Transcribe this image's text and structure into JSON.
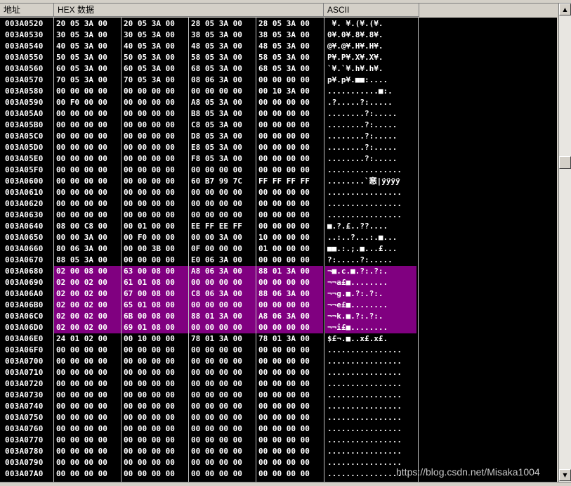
{
  "header": {
    "addr_label": "地址",
    "hex_label": "HEX 数据",
    "ascii_label": "ASCII"
  },
  "scrollbar": {
    "up_glyph": "▲",
    "down_glyph": "▼"
  },
  "watermark": "https://blog.csdn.net/Misaka1004",
  "rows": [
    {
      "addr": "003A0520",
      "g": [
        "20 05 3A 00",
        "20 05 3A 00",
        "28 05 3A 00",
        "28 05 3A 00"
      ],
      "ascii": " ¥. ¥.(¥.(¥.",
      "sel": false
    },
    {
      "addr": "003A0530",
      "g": [
        "30 05 3A 00",
        "30 05 3A 00",
        "38 05 3A 00",
        "38 05 3A 00"
      ],
      "ascii": "0¥.0¥.8¥.8¥.",
      "sel": false
    },
    {
      "addr": "003A0540",
      "g": [
        "40 05 3A 00",
        "40 05 3A 00",
        "48 05 3A 00",
        "48 05 3A 00"
      ],
      "ascii": "@¥.@¥.H¥.H¥.",
      "sel": false
    },
    {
      "addr": "003A0550",
      "g": [
        "50 05 3A 00",
        "50 05 3A 00",
        "58 05 3A 00",
        "58 05 3A 00"
      ],
      "ascii": "P¥.P¥.X¥.X¥.",
      "sel": false
    },
    {
      "addr": "003A0560",
      "g": [
        "60 05 3A 00",
        "60 05 3A 00",
        "68 05 3A 00",
        "68 05 3A 00"
      ],
      "ascii": "`¥.`¥.h¥.h¥.",
      "sel": false
    },
    {
      "addr": "003A0570",
      "g": [
        "70 05 3A 00",
        "70 05 3A 00",
        "08 06 3A 00",
        "00 00 00 00"
      ],
      "ascii": "p¥.p¥.■■:....",
      "sel": false
    },
    {
      "addr": "003A0580",
      "g": [
        "00 00 00 00",
        "00 00 00 00",
        "00 00 00 00",
        "00 10 3A 00"
      ],
      "ascii": "...........■:.",
      "sel": false
    },
    {
      "addr": "003A0590",
      "g": [
        "00 F0 00 00",
        "00 00 00 00",
        "A8 05 3A 00",
        "00 00 00 00"
      ],
      "ascii": ".?.....?:.....",
      "sel": false
    },
    {
      "addr": "003A05A0",
      "g": [
        "00 00 00 00",
        "00 00 00 00",
        "B8 05 3A 00",
        "00 00 00 00"
      ],
      "ascii": "........?:.....",
      "sel": false
    },
    {
      "addr": "003A05B0",
      "g": [
        "00 00 00 00",
        "00 00 00 00",
        "C8 05 3A 00",
        "00 00 00 00"
      ],
      "ascii": "........?:.....",
      "sel": false
    },
    {
      "addr": "003A05C0",
      "g": [
        "00 00 00 00",
        "00 00 00 00",
        "D8 05 3A 00",
        "00 00 00 00"
      ],
      "ascii": "........?:.....",
      "sel": false
    },
    {
      "addr": "003A05D0",
      "g": [
        "00 00 00 00",
        "00 00 00 00",
        "E8 05 3A 00",
        "00 00 00 00"
      ],
      "ascii": "........?:.....",
      "sel": false
    },
    {
      "addr": "003A05E0",
      "g": [
        "00 00 00 00",
        "00 00 00 00",
        "F8 05 3A 00",
        "00 00 00 00"
      ],
      "ascii": "........?:.....",
      "sel": false
    },
    {
      "addr": "003A05F0",
      "g": [
        "00 00 00 00",
        "00 00 00 00",
        "00 00 00 00",
        "00 00 00 00"
      ],
      "ascii": "................",
      "sel": false
    },
    {
      "addr": "003A0600",
      "g": [
        "00 00 00 00",
        "00 00 00 00",
        "60 B7 99 7C",
        "FF FF FF FF"
      ],
      "ascii": "........`窸|ÿÿÿÿ",
      "sel": false
    },
    {
      "addr": "003A0610",
      "g": [
        "00 00 00 00",
        "00 00 00 00",
        "00 00 00 00",
        "00 00 00 00"
      ],
      "ascii": "................",
      "sel": false
    },
    {
      "addr": "003A0620",
      "g": [
        "00 00 00 00",
        "00 00 00 00",
        "00 00 00 00",
        "00 00 00 00"
      ],
      "ascii": "................",
      "sel": false
    },
    {
      "addr": "003A0630",
      "g": [
        "00 00 00 00",
        "00 00 00 00",
        "00 00 00 00",
        "00 00 00 00"
      ],
      "ascii": "................",
      "sel": false
    },
    {
      "addr": "003A0640",
      "g": [
        "08 00 C8 00",
        "00 01 00 00",
        "EE FF EE FF",
        "00 00 00 00"
      ],
      "ascii": "■.?.£..??....",
      "sel": false
    },
    {
      "addr": "003A0650",
      "g": [
        "00 00 3A 00",
        "00 F0 00 00",
        "00 00 3A 00",
        "10 00 00 00"
      ],
      "ascii": "..:..?...:.■...",
      "sel": false
    },
    {
      "addr": "003A0660",
      "g": [
        "80 06 3A 00",
        "00 00 3B 00",
        "0F 00 00 00",
        "01 00 00 00"
      ],
      "ascii": "■■.:.;.■...£...",
      "sel": false
    },
    {
      "addr": "003A0670",
      "g": [
        "88 05 3A 00",
        "00 00 00 00",
        "E0 06 3A 00",
        "00 00 00 00"
      ],
      "ascii": "?:.....?:.....",
      "sel": false
    },
    {
      "addr": "003A0680",
      "g": [
        "02 00 08 00",
        "63 00 08 00",
        "A8 06 3A 00",
        "88 01 3A 00"
      ],
      "ascii": "¬■.c.■.?:.?:.",
      "sel": true
    },
    {
      "addr": "003A0690",
      "g": [
        "02 00 02 00",
        "61 01 08 00",
        "00 00 00 00",
        "00 00 00 00"
      ],
      "ascii": "¬¬a£■........",
      "sel": true
    },
    {
      "addr": "003A06A0",
      "g": [
        "02 00 02 00",
        "67 00 08 00",
        "C8 06 3A 00",
        "88 06 3A 00"
      ],
      "ascii": "¬¬g.■.?:.?:.",
      "sel": true
    },
    {
      "addr": "003A06B0",
      "g": [
        "02 00 02 00",
        "65 01 08 00",
        "00 00 00 00",
        "00 00 00 00"
      ],
      "ascii": "¬¬e£■........",
      "sel": true
    },
    {
      "addr": "003A06C0",
      "g": [
        "02 00 02 00",
        "6B 00 08 00",
        "88 01 3A 00",
        "A8 06 3A 00"
      ],
      "ascii": "¬¬k.■.?:.?:.",
      "sel": true
    },
    {
      "addr": "003A06D0",
      "g": [
        "02 00 02 00",
        "69 01 08 00",
        "00 00 00 00",
        "00 00 00 00"
      ],
      "ascii": "¬¬i£■........",
      "sel": true
    },
    {
      "addr": "003A06E0",
      "g": [
        "24 01 02 00",
        "00 10 00 00",
        "78 01 3A 00",
        "78 01 3A 00"
      ],
      "ascii": "$£¬.■..x£.x£.",
      "sel": false
    },
    {
      "addr": "003A06F0",
      "g": [
        "00 00 00 00",
        "00 00 00 00",
        "00 00 00 00",
        "00 00 00 00"
      ],
      "ascii": "................",
      "sel": false
    },
    {
      "addr": "003A0700",
      "g": [
        "00 00 00 00",
        "00 00 00 00",
        "00 00 00 00",
        "00 00 00 00"
      ],
      "ascii": "................",
      "sel": false
    },
    {
      "addr": "003A0710",
      "g": [
        "00 00 00 00",
        "00 00 00 00",
        "00 00 00 00",
        "00 00 00 00"
      ],
      "ascii": "................",
      "sel": false
    },
    {
      "addr": "003A0720",
      "g": [
        "00 00 00 00",
        "00 00 00 00",
        "00 00 00 00",
        "00 00 00 00"
      ],
      "ascii": "................",
      "sel": false
    },
    {
      "addr": "003A0730",
      "g": [
        "00 00 00 00",
        "00 00 00 00",
        "00 00 00 00",
        "00 00 00 00"
      ],
      "ascii": "................",
      "sel": false
    },
    {
      "addr": "003A0740",
      "g": [
        "00 00 00 00",
        "00 00 00 00",
        "00 00 00 00",
        "00 00 00 00"
      ],
      "ascii": "................",
      "sel": false
    },
    {
      "addr": "003A0750",
      "g": [
        "00 00 00 00",
        "00 00 00 00",
        "00 00 00 00",
        "00 00 00 00"
      ],
      "ascii": "................",
      "sel": false
    },
    {
      "addr": "003A0760",
      "g": [
        "00 00 00 00",
        "00 00 00 00",
        "00 00 00 00",
        "00 00 00 00"
      ],
      "ascii": "................",
      "sel": false
    },
    {
      "addr": "003A0770",
      "g": [
        "00 00 00 00",
        "00 00 00 00",
        "00 00 00 00",
        "00 00 00 00"
      ],
      "ascii": "................",
      "sel": false
    },
    {
      "addr": "003A0780",
      "g": [
        "00 00 00 00",
        "00 00 00 00",
        "00 00 00 00",
        "00 00 00 00"
      ],
      "ascii": "................",
      "sel": false
    },
    {
      "addr": "003A0790",
      "g": [
        "00 00 00 00",
        "00 00 00 00",
        "00 00 00 00",
        "00 00 00 00"
      ],
      "ascii": "................",
      "sel": false
    },
    {
      "addr": "003A07A0",
      "g": [
        "00 00 00 00",
        "00 00 00 00",
        "00 00 00 00",
        "00 00 00 00"
      ],
      "ascii": "................",
      "sel": false
    }
  ]
}
